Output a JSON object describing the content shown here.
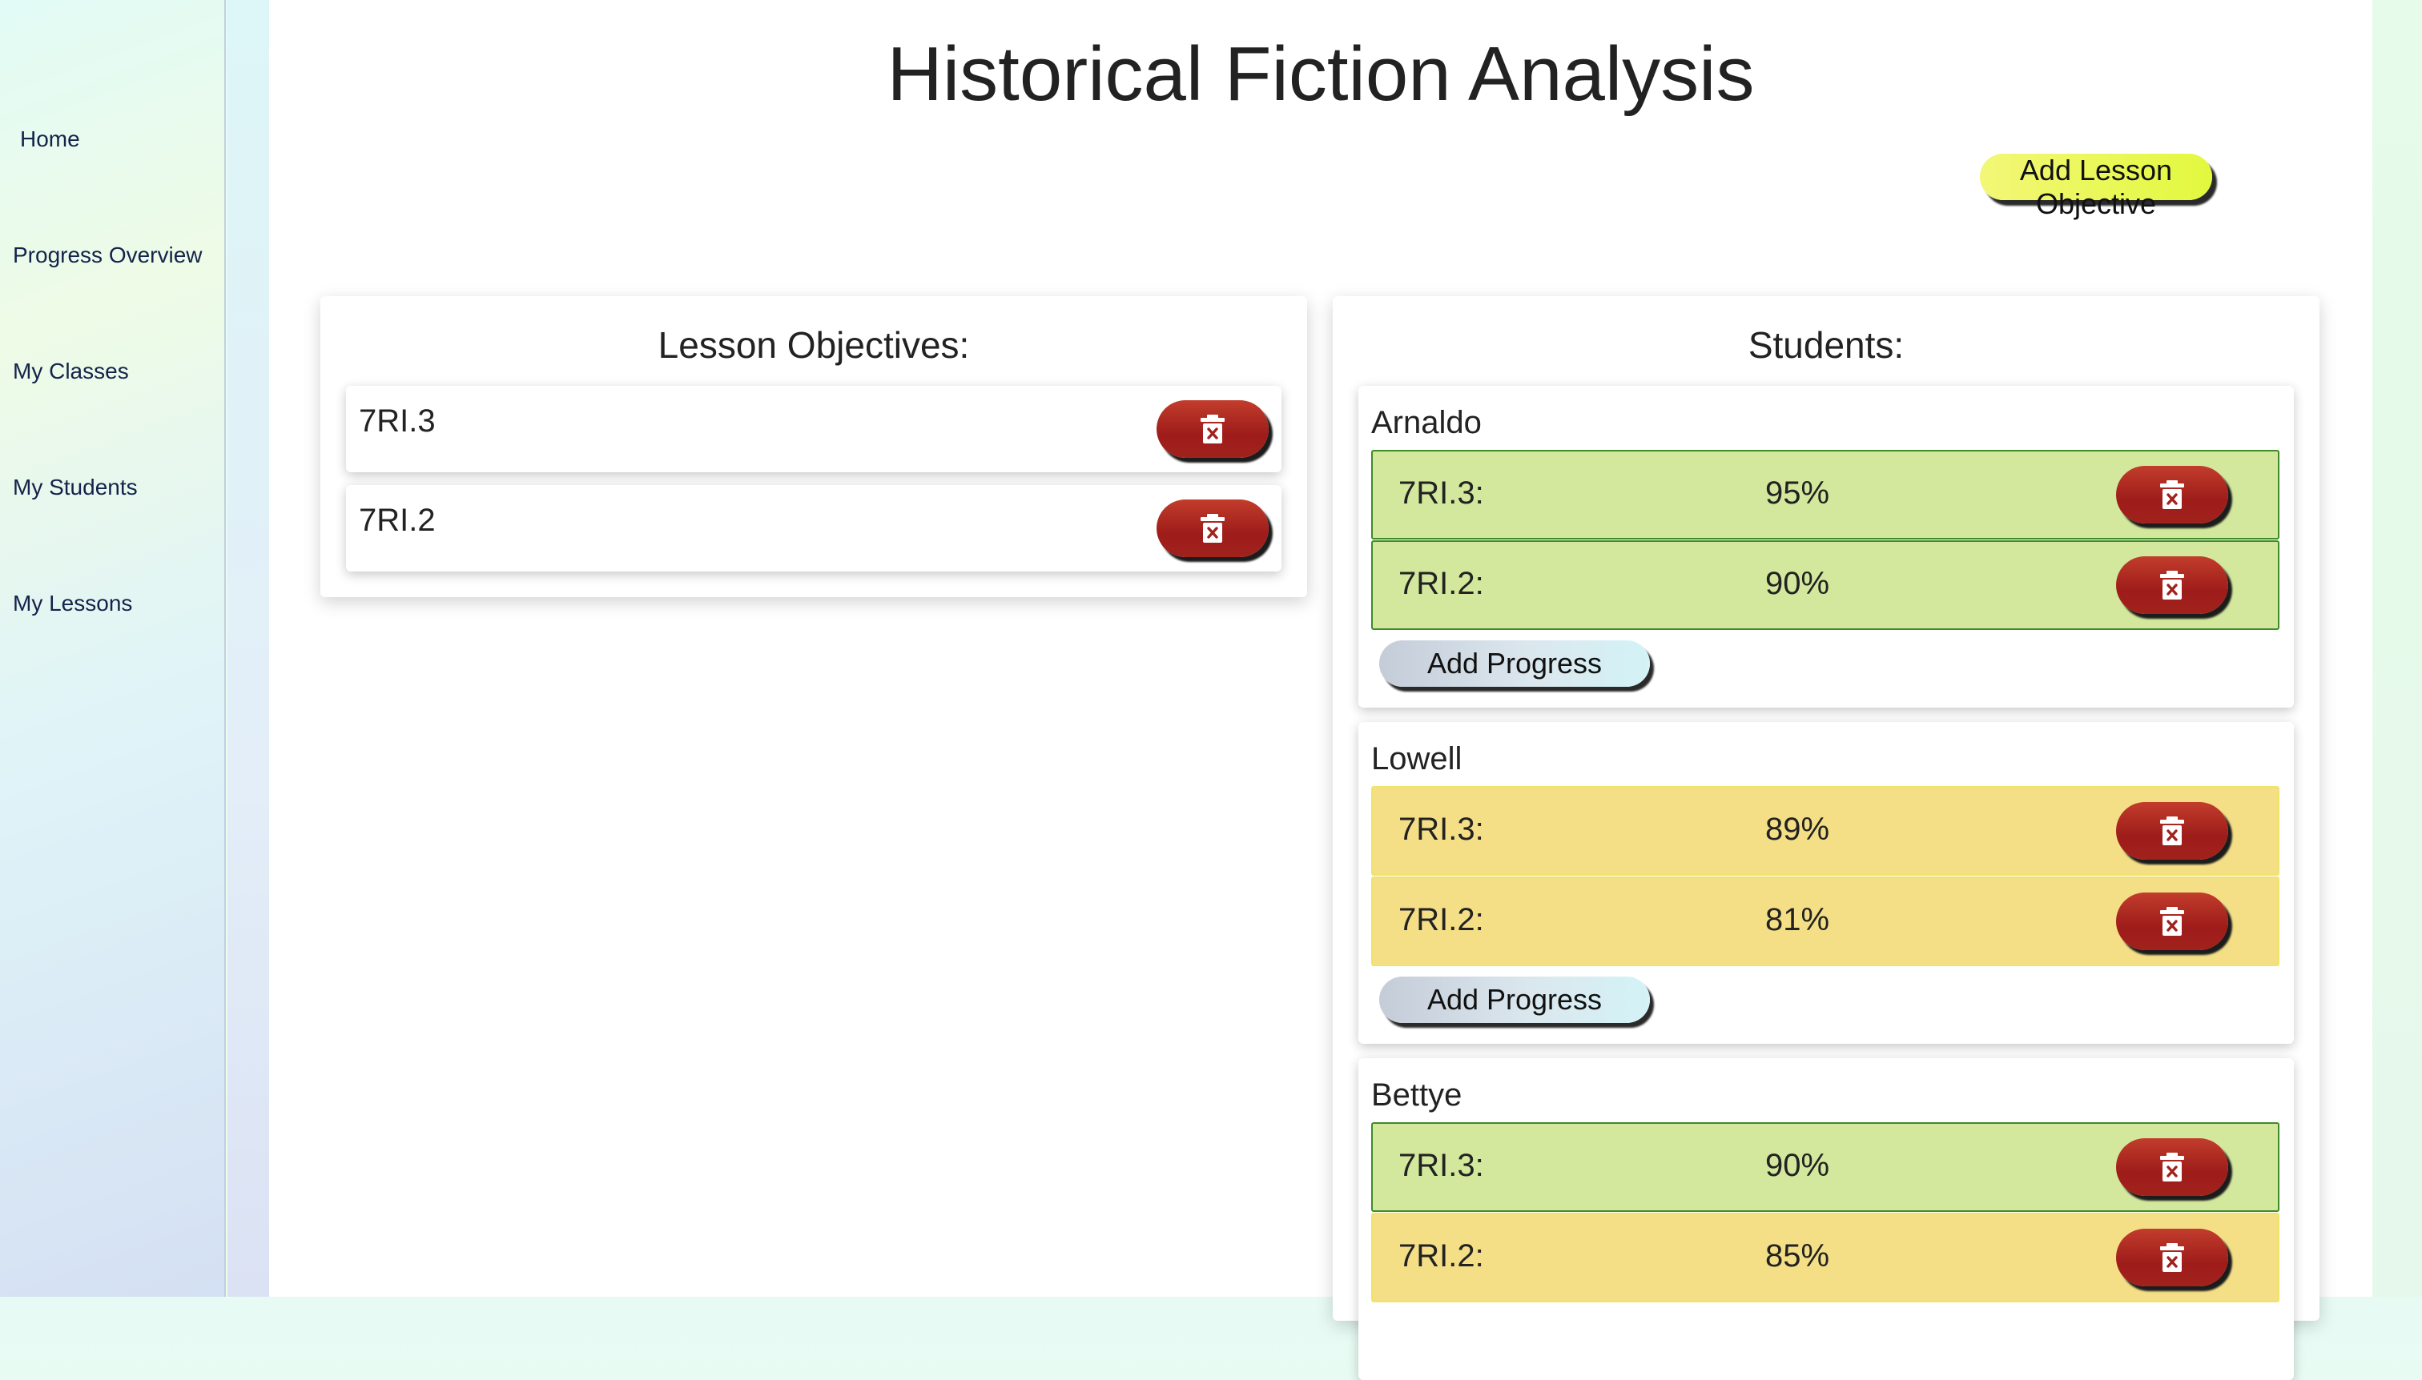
{
  "sidebar": {
    "items": [
      {
        "label": "Home"
      },
      {
        "label": "Progress Overview"
      },
      {
        "label": "My Classes"
      },
      {
        "label": "My Students"
      },
      {
        "label": "My Lessons"
      }
    ]
  },
  "page": {
    "title": "Historical Fiction Analysis",
    "add_objective_label": "Add Lesson Objective"
  },
  "objectives_panel": {
    "title": "Lesson Objectives:",
    "items": [
      {
        "code": "7RI.3"
      },
      {
        "code": "7RI.2"
      }
    ]
  },
  "students_panel": {
    "title": "Students:",
    "add_progress_label": "Add Progress",
    "students": [
      {
        "name": "Arnaldo",
        "progress": [
          {
            "code": "7RI.3:",
            "percent": "95%",
            "status": "green"
          },
          {
            "code": "7RI.2:",
            "percent": "90%",
            "status": "green"
          }
        ]
      },
      {
        "name": "Lowell",
        "progress": [
          {
            "code": "7RI.3:",
            "percent": "89%",
            "status": "yellow"
          },
          {
            "code": "7RI.2:",
            "percent": "81%",
            "status": "yellow"
          }
        ]
      },
      {
        "name": "Bettye",
        "progress": [
          {
            "code": "7RI.3:",
            "percent": "90%",
            "status": "green"
          },
          {
            "code": "7RI.2:",
            "percent": "85%",
            "status": "yellow"
          }
        ]
      }
    ]
  },
  "colors": {
    "high_progress": "#d3e89c",
    "mid_progress": "#f4df86",
    "delete_button": "#a1221d",
    "add_objective_button": "#e6f85a"
  },
  "icons": {
    "delete": "trash-icon"
  }
}
